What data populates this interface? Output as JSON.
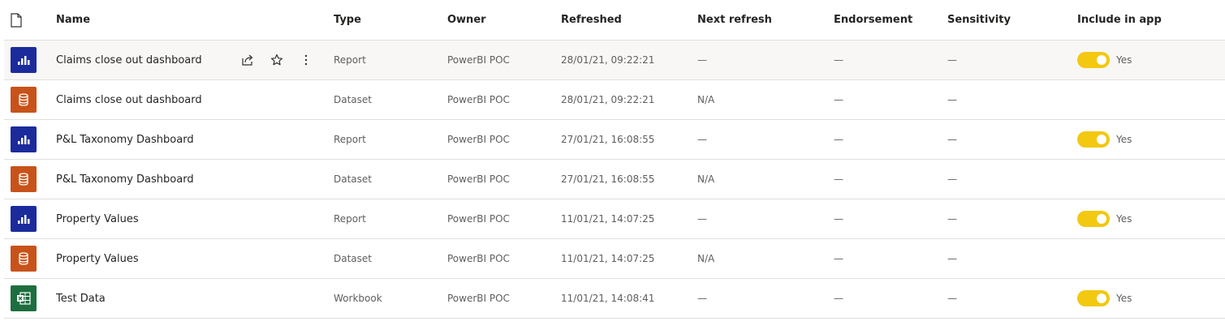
{
  "header": {
    "icon": "document-icon",
    "name": "Name",
    "type": "Type",
    "owner": "Owner",
    "refreshed": "Refreshed",
    "next_refresh": "Next refresh",
    "endorsement": "Endorsement",
    "sensitivity": "Sensitivity",
    "include_in_app": "Include in app"
  },
  "colors": {
    "report": "#1b2b9c",
    "dataset": "#c8531a",
    "workbook": "#1d6e3e",
    "toggle_on": "#f2c811"
  },
  "rows": [
    {
      "kind": "report",
      "icon": "report-icon",
      "name": "Claims close out dashboard",
      "type": "Report",
      "owner": "PowerBI POC",
      "refreshed": "28/01/21, 09:22:21",
      "next_refresh": "—",
      "endorsement": "—",
      "sensitivity": "—",
      "include": true,
      "include_label": "Yes",
      "hover": true
    },
    {
      "kind": "dataset",
      "icon": "dataset-icon",
      "name": "Claims close out dashboard",
      "type": "Dataset",
      "owner": "PowerBI POC",
      "refreshed": "28/01/21, 09:22:21",
      "next_refresh": "N/A",
      "endorsement": "—",
      "sensitivity": "—",
      "include": false,
      "include_label": ""
    },
    {
      "kind": "report",
      "icon": "report-icon",
      "name": "P&L Taxonomy Dashboard",
      "type": "Report",
      "owner": "PowerBI POC",
      "refreshed": "27/01/21, 16:08:55",
      "next_refresh": "—",
      "endorsement": "—",
      "sensitivity": "—",
      "include": true,
      "include_label": "Yes"
    },
    {
      "kind": "dataset",
      "icon": "dataset-icon",
      "name": "P&L Taxonomy Dashboard",
      "type": "Dataset",
      "owner": "PowerBI POC",
      "refreshed": "27/01/21, 16:08:55",
      "next_refresh": "N/A",
      "endorsement": "—",
      "sensitivity": "—",
      "include": false,
      "include_label": ""
    },
    {
      "kind": "report",
      "icon": "report-icon",
      "name": "Property Values",
      "type": "Report",
      "owner": "PowerBI POC",
      "refreshed": "11/01/21, 14:07:25",
      "next_refresh": "—",
      "endorsement": "—",
      "sensitivity": "—",
      "include": true,
      "include_label": "Yes"
    },
    {
      "kind": "dataset",
      "icon": "dataset-icon",
      "name": "Property Values",
      "type": "Dataset",
      "owner": "PowerBI POC",
      "refreshed": "11/01/21, 14:07:25",
      "next_refresh": "N/A",
      "endorsement": "—",
      "sensitivity": "—",
      "include": false,
      "include_label": ""
    },
    {
      "kind": "workbook",
      "icon": "excel-workbook-icon",
      "name": "Test Data",
      "type": "Workbook",
      "owner": "PowerBI POC",
      "refreshed": "11/01/21, 14:08:41",
      "next_refresh": "—",
      "endorsement": "—",
      "sensitivity": "—",
      "include": true,
      "include_label": "Yes"
    }
  ],
  "row_actions": [
    {
      "icon": "share-icon"
    },
    {
      "icon": "star-icon"
    },
    {
      "icon": "more-options-icon"
    }
  ]
}
